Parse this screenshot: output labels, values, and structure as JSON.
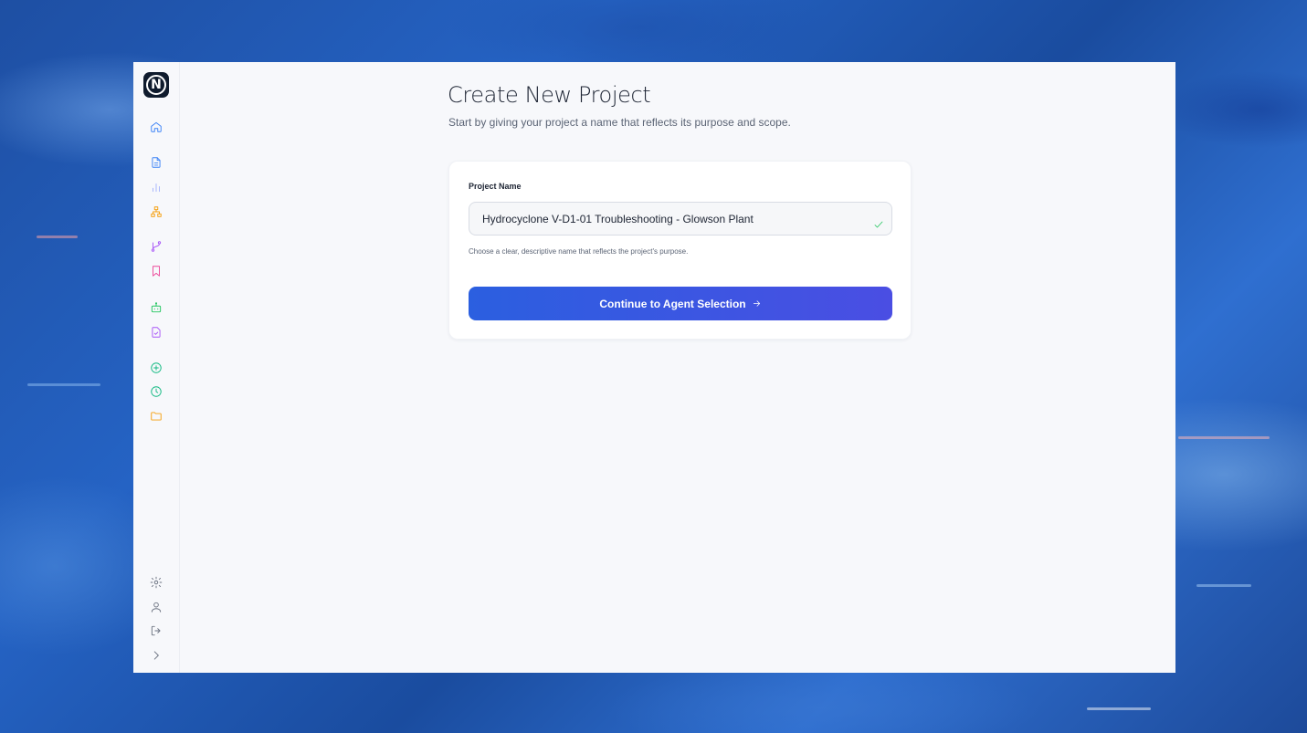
{
  "app": {
    "logo_letter": "N"
  },
  "sidebar": {
    "items": [
      {
        "icon": "home-icon",
        "color": "#3b82f6"
      },
      {
        "icon": "document-icon",
        "color": "#3b82f6"
      },
      {
        "icon": "bar-chart-icon",
        "color": "#a5b4fc"
      },
      {
        "icon": "network-icon",
        "color": "#f59e0b"
      },
      {
        "icon": "git-branch-icon",
        "color": "#a855f7"
      },
      {
        "icon": "bookmark-icon",
        "color": "#ec4899"
      },
      {
        "icon": "bot-icon",
        "color": "#22c55e"
      },
      {
        "icon": "file-check-icon",
        "color": "#a855f7"
      },
      {
        "icon": "plus-circle-icon",
        "color": "#10b981"
      },
      {
        "icon": "clock-icon",
        "color": "#10b981"
      },
      {
        "icon": "folder-icon",
        "color": "#f59e0b"
      }
    ],
    "bottom_items": [
      {
        "icon": "gear-icon",
        "color": "#6b7280"
      },
      {
        "icon": "user-icon",
        "color": "#6b7280"
      },
      {
        "icon": "logout-icon",
        "color": "#6b7280"
      },
      {
        "icon": "chevron-right-icon",
        "color": "#6b7280"
      }
    ]
  },
  "main": {
    "title": "Create New Project",
    "subtitle": "Start by giving your project a name that reflects its purpose and scope.",
    "form": {
      "label": "Project Name",
      "value": "Hydrocyclone V-D1-01 Troubleshooting - Glowson Plant",
      "helper": "Choose a clear, descriptive name that reflects the project's purpose.",
      "valid_color": "#22c55e",
      "button_label": "Continue to Agent Selection"
    }
  },
  "colors": {
    "button_start": "#2b5fe0",
    "button_end": "#4a4ee3",
    "background": "#f7f8fb"
  }
}
